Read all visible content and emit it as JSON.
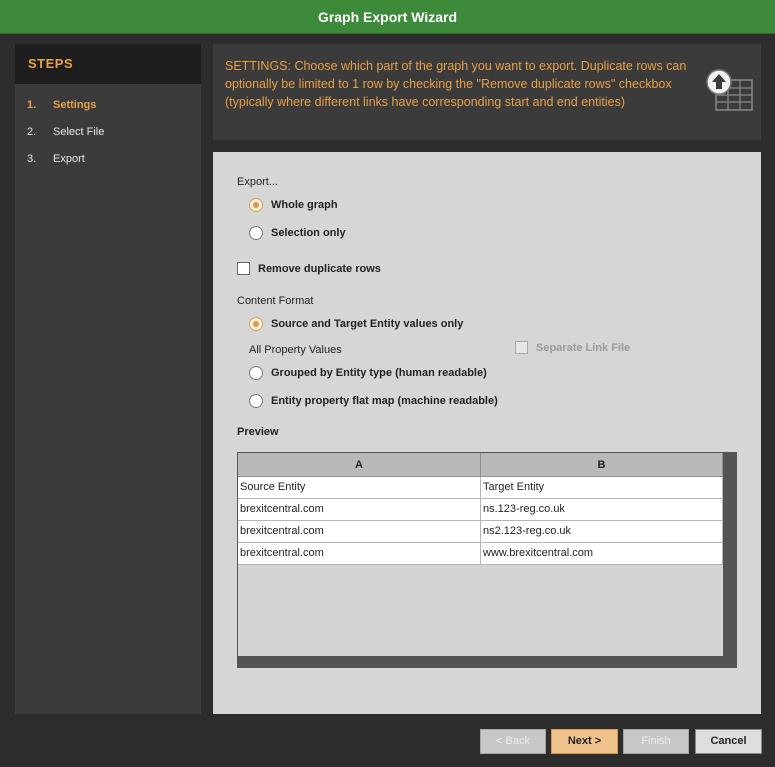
{
  "window": {
    "title": "Graph Export Wizard"
  },
  "steps": {
    "header": "STEPS",
    "items": [
      {
        "num": "1.",
        "label": "Settings",
        "active": true
      },
      {
        "num": "2.",
        "label": "Select File",
        "active": false
      },
      {
        "num": "3.",
        "label": "Export",
        "active": false
      }
    ]
  },
  "description": "SETTINGS: Choose which part of the graph you want to export. Duplicate rows can optionally be limited to 1 row by checking the \"Remove duplicate rows\" checkbox (typically where different links have corresponding start and end entities)",
  "export_icon": "upload-table-icon",
  "settings": {
    "export_label": "Export...",
    "whole_graph": "Whole graph",
    "selection_only": "Selection only",
    "selected_scope": "Whole graph",
    "remove_duplicates": "Remove duplicate rows",
    "remove_duplicates_checked": false,
    "content_format_label": "Content Format",
    "source_target": "Source and Target Entity values only",
    "all_property_values": "All Property Values",
    "separate_link_file": "Separate Link File",
    "grouped_by_type": "Grouped by Entity type (human readable)",
    "flat_map": "Entity property flat map (machine readable)",
    "selected_format": "Source and Target Entity values only"
  },
  "preview": {
    "label": "Preview",
    "columns": [
      "A",
      "B"
    ],
    "rows": [
      [
        "Source Entity",
        "Target Entity"
      ],
      [
        "brexitcentral.com",
        "ns.123-reg.co.uk"
      ],
      [
        "brexitcentral.com",
        "ns2.123-reg.co.uk"
      ],
      [
        "brexitcentral.com",
        "www.brexitcentral.com"
      ]
    ]
  },
  "buttons": {
    "back": "< Back",
    "next": "Next >",
    "finish": "Finish",
    "cancel": "Cancel"
  },
  "colors": {
    "accent": "#e8a04a",
    "titlebar": "#3e8a3b",
    "panel": "#d6d6d6"
  }
}
